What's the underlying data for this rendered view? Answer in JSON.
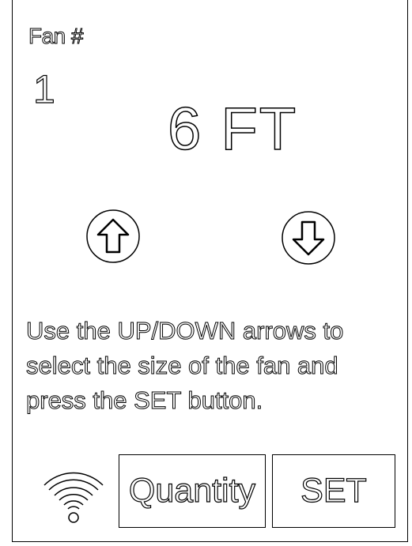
{
  "fan": {
    "label": "Fan #",
    "number": "1",
    "size": "6 FT"
  },
  "instructions": {
    "line1": "Use the UP/DOWN arrows to",
    "line2": "select the size of the fan and",
    "line3": "press the SET button."
  },
  "buttons": {
    "quantity_label": "Quantity",
    "set_label": "SET"
  },
  "icons": {
    "up": "arrow-up-circle-icon",
    "down": "arrow-down-circle-icon",
    "wifi": "wifi-icon"
  }
}
